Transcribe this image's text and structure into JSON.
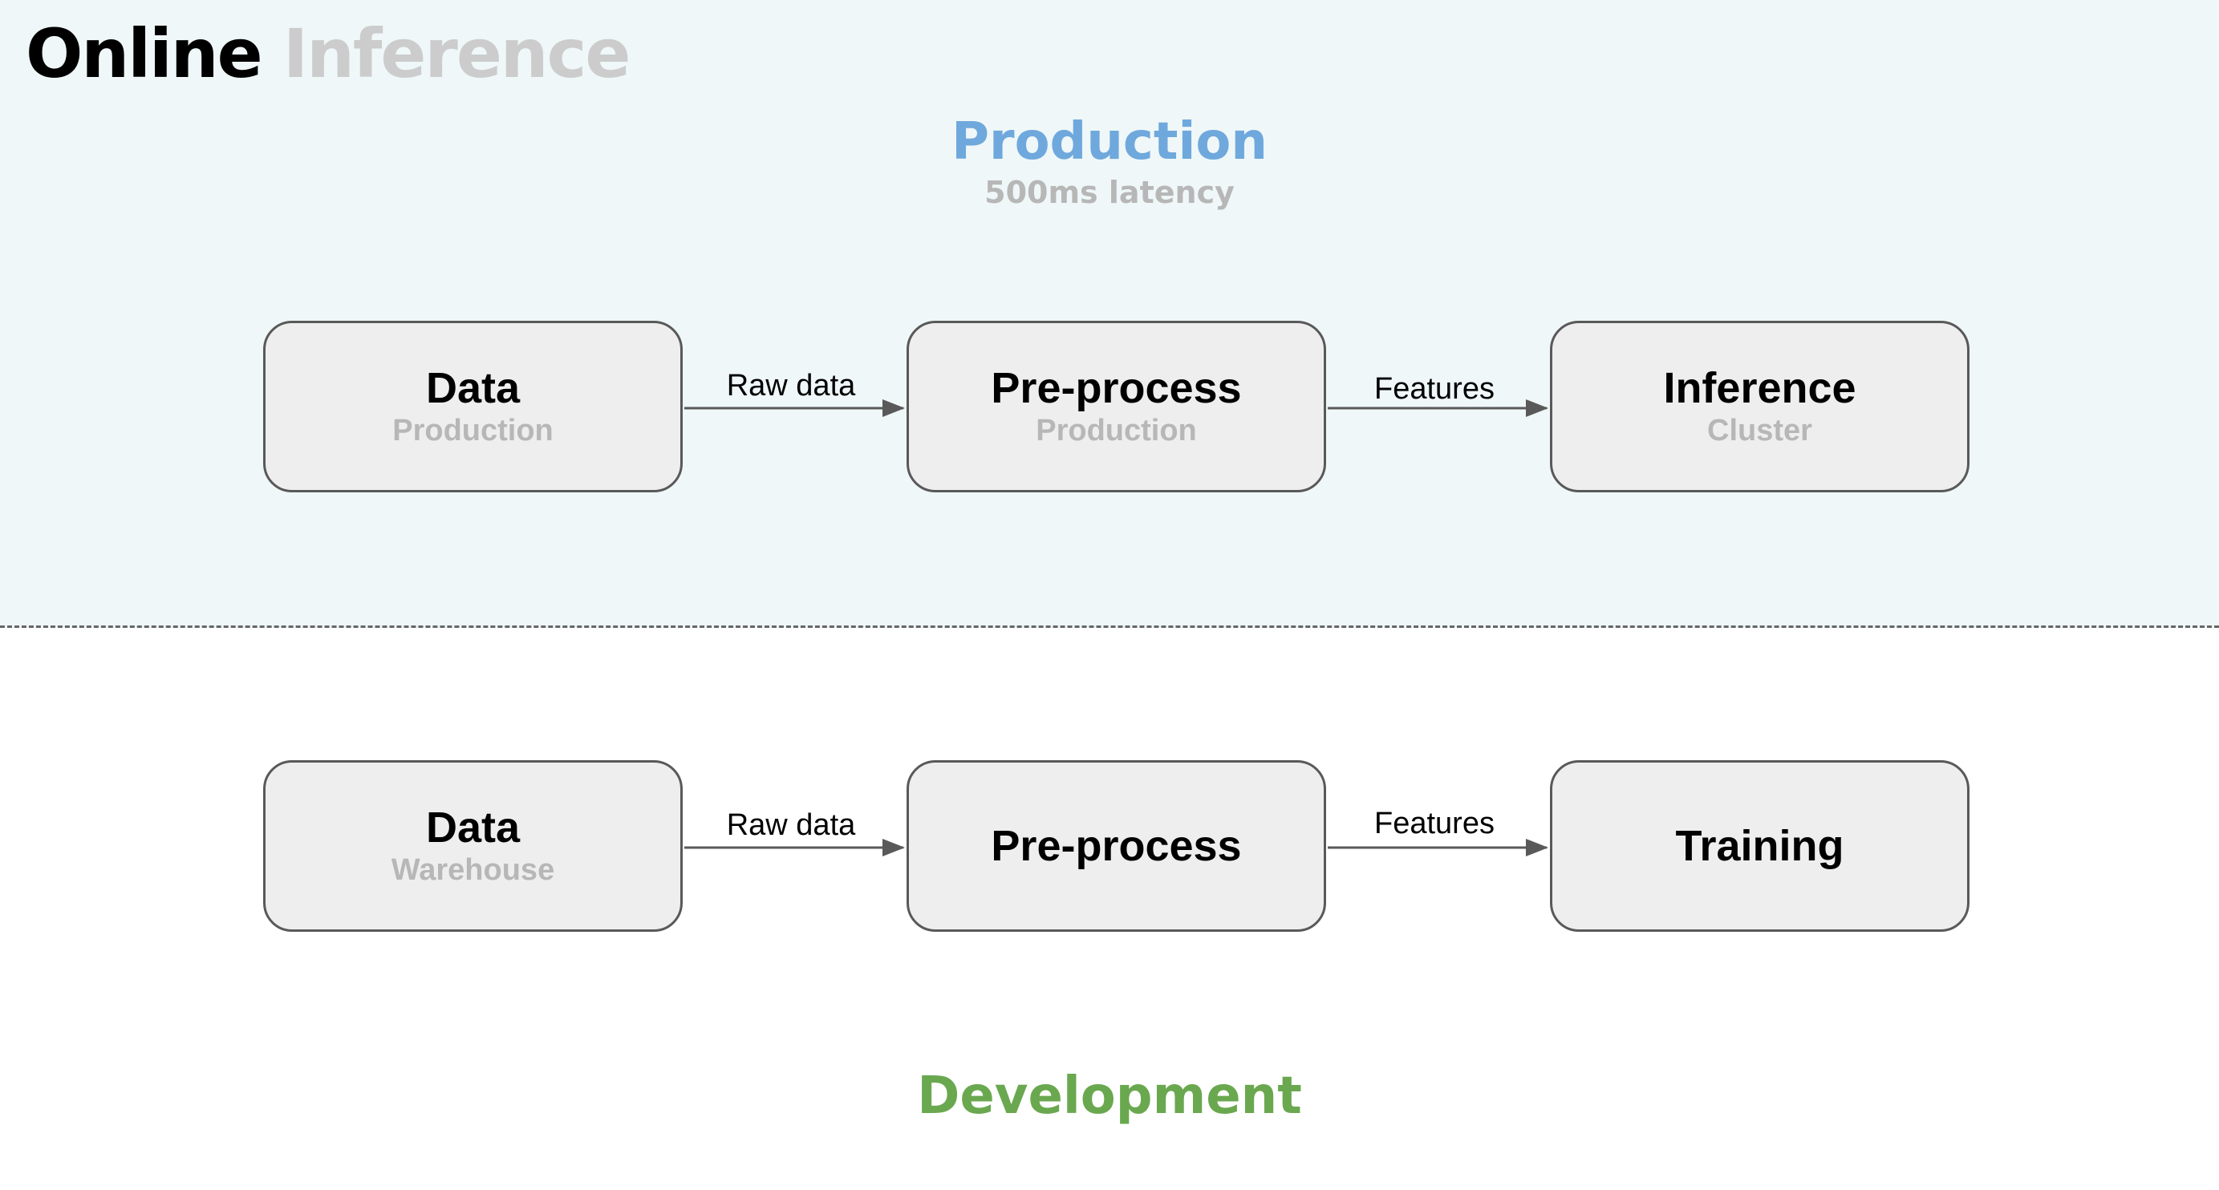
{
  "title": {
    "part1": "Online",
    "part2": "Inference"
  },
  "production": {
    "title": "Production",
    "subtitle": "500ms latency",
    "nodes": [
      {
        "main": "Data",
        "sub": "Production"
      },
      {
        "main": "Pre-process",
        "sub": "Production"
      },
      {
        "main": "Inference",
        "sub": "Cluster"
      }
    ],
    "edges": [
      {
        "from": 0,
        "to": 1,
        "label": "Raw data"
      },
      {
        "from": 1,
        "to": 2,
        "label": "Features"
      }
    ]
  },
  "development": {
    "title": "Development",
    "nodes": [
      {
        "main": "Data",
        "sub": "Warehouse"
      },
      {
        "main": "Pre-process",
        "sub": ""
      },
      {
        "main": "Training",
        "sub": ""
      }
    ],
    "edges": [
      {
        "from": 0,
        "to": 1,
        "label": "Raw data"
      },
      {
        "from": 1,
        "to": 2,
        "label": "Features"
      }
    ]
  },
  "colors": {
    "production_accent": "#6fa8dc",
    "development_accent": "#6aa84f",
    "production_bg": "#eff7f8",
    "node_fill": "#eeeeee",
    "node_border": "#595959",
    "muted_text": "#b7b7b7"
  }
}
